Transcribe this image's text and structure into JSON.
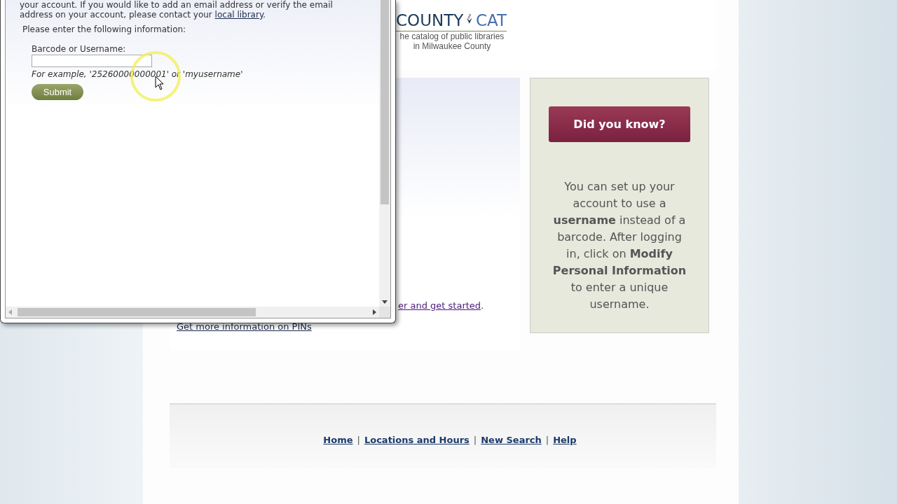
{
  "popup": {
    "intro": {
      "text": "your account. If you would like to add an email address or verify the email address on your account, please contact your ",
      "link": "local library",
      "end": "."
    },
    "instruction": "Please enter the following information:",
    "field": {
      "label": "Barcode or Username:",
      "hint": "For example, '25260000000001' or 'myusername'"
    },
    "submit": "Submit"
  },
  "logo": {
    "word_1": "COUNTY",
    "word_2": "CAT",
    "tagline": [
      "he catalog of public libraries",
      "in Milwaukee County"
    ]
  },
  "content": {
    "link_fragment": "er and get started",
    "link_end": ".",
    "pins_link": "Get more information on PINs"
  },
  "tip": {
    "title": "Did you know?",
    "body": "You can set up your account to use a **username** instead of a barcode. After logging in, click on **Modify Personal Information** to enter a unique username."
  },
  "footer": {
    "links": [
      "Home",
      "Locations and Hours",
      "New Search",
      "Help"
    ],
    "separator": "|"
  }
}
